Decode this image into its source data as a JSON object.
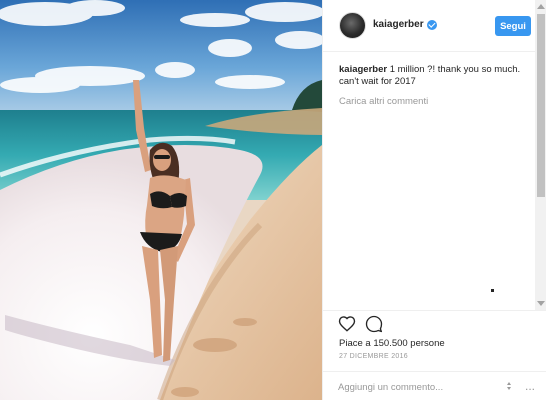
{
  "post": {
    "username": "kaiagerber",
    "follow_label": "Segui",
    "caption_user": "kaiagerber",
    "caption_text": " 1 million ?! thank you so much. can't wait for 2017",
    "load_more_label": "Carica altri commenti",
    "likes_text": "Piace a 150.500 persone",
    "date_text": "27 DICEMBRE 2016",
    "comment_placeholder": "Aggiungi un commento...",
    "more_label": "..."
  },
  "icons": {
    "like": "heart-icon",
    "comment": "speech-bubble-icon",
    "verified": "verified-badge-icon"
  },
  "colors": {
    "accent": "#3897f0",
    "text": "#262626",
    "muted": "#999999"
  }
}
